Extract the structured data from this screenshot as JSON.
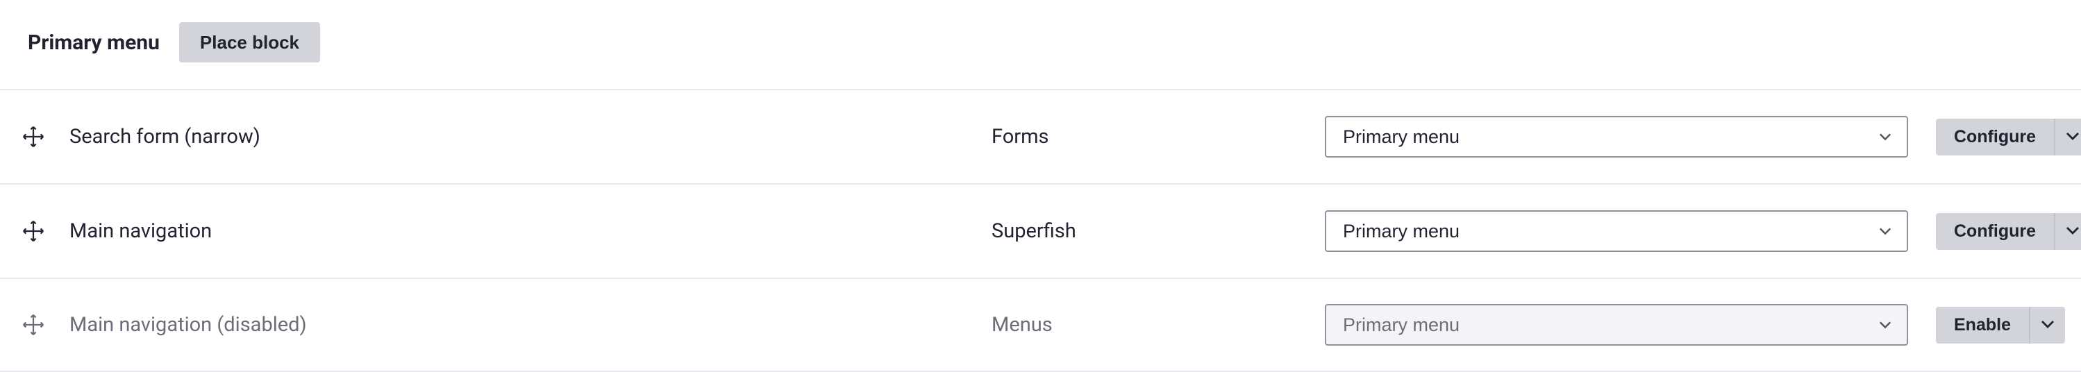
{
  "region": {
    "title": "Primary menu",
    "place_block_label": "Place block"
  },
  "rows": [
    {
      "name": "Search form (narrow)",
      "category": "Forms",
      "region_select": "Primary menu",
      "op_label": "Configure",
      "disabled": false
    },
    {
      "name": "Main navigation",
      "category": "Superfish",
      "region_select": "Primary menu",
      "op_label": "Configure",
      "disabled": false
    },
    {
      "name": "Main navigation (disabled)",
      "category": "Menus",
      "region_select": "Primary menu",
      "op_label": "Enable",
      "disabled": true
    }
  ]
}
